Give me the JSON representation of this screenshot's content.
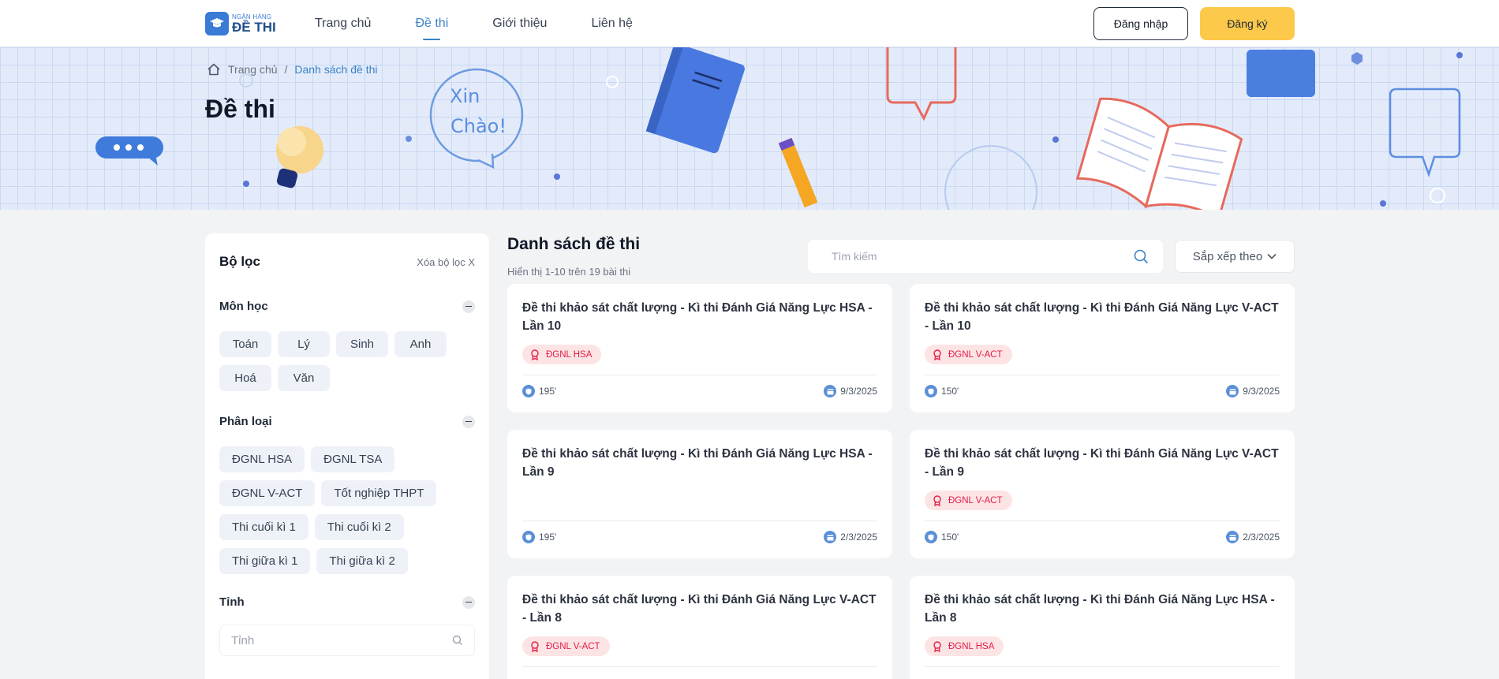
{
  "header": {
    "logo_small": "NGÂN HÀNG",
    "logo_big": "ĐỀ THI",
    "nav": [
      {
        "label": "Trang chủ"
      },
      {
        "label": "Đề thi"
      },
      {
        "label": "Giới thiệu"
      },
      {
        "label": "Liên hệ"
      }
    ],
    "active_nav": "Đề thi",
    "login_label": "Đăng nhập",
    "register_label": "Đăng ký"
  },
  "banner": {
    "breadcrumb_home": "Trang chủ",
    "breadcrumb_sep": "/",
    "breadcrumb_current": "Danh sách đề thi",
    "page_title": "Đề thi",
    "bubble_line1": "Xin",
    "bubble_line2": "Chào!"
  },
  "filter": {
    "title": "Bộ lọc",
    "clear_label": "Xóa bộ lọc X",
    "subject_title": "Môn học",
    "subjects": [
      "Toán",
      "Lý",
      "Sinh",
      "Anh",
      "Hoá",
      "Văn"
    ],
    "category_title": "Phân loại",
    "categories": [
      "ĐGNL HSA",
      "ĐGNL TSA",
      "ĐGNL V-ACT",
      "Tốt nghiệp THPT",
      "Thi cuối kì 1",
      "Thi cuối kì 2",
      "Thi giữa kì 1",
      "Thi giữa kì 2"
    ],
    "province_title": "Tỉnh",
    "province_placeholder": "Tỉnh"
  },
  "list": {
    "title": "Danh sách đề thi",
    "subtitle": "Hiển thị 1-10 trên 19 bài thi",
    "search_placeholder": "Tìm kiếm",
    "sort_label": "Sắp xếp theo",
    "cards": [
      {
        "title": "Đề thi khảo sát chất lượng - Kì thi Đánh Giá Năng Lực HSA - Lần 10",
        "tag": "ĐGNL HSA",
        "duration": "195'",
        "date": "9/3/2025"
      },
      {
        "title": "Đề thi khảo sát chất lượng - Kì thi Đánh Giá Năng Lực V-ACT - Lần 10",
        "tag": "ĐGNL V-ACT",
        "duration": "150'",
        "date": "9/3/2025"
      },
      {
        "title": "Đề thi khảo sát chất lượng - Kì thi Đánh Giá Năng Lực HSA - Lần 9",
        "tag": "",
        "duration": "195'",
        "date": "2/3/2025"
      },
      {
        "title": "Đề thi khảo sát chất lượng - Kì thi Đánh Giá Năng Lực V-ACT - Lần 9",
        "tag": "ĐGNL V-ACT",
        "duration": "150'",
        "date": "2/3/2025"
      },
      {
        "title": "Đề thi khảo sát chất lượng - Kì thi Đánh Giá Năng Lực V-ACT - Lần 8",
        "tag": "ĐGNL V-ACT",
        "duration": "",
        "date": ""
      },
      {
        "title": "Đề thi khảo sát chất lượng - Kì thi Đánh Giá Năng Lực HSA - Lần 8",
        "tag": "ĐGNL HSA",
        "duration": "",
        "date": ""
      }
    ]
  },
  "colors": {
    "accent": "#3b82c4",
    "register_button": "#fcc94a",
    "tag_bg": "#fde4e4",
    "tag_text": "#e11d48",
    "banner_bg": "#e3ebfa"
  }
}
